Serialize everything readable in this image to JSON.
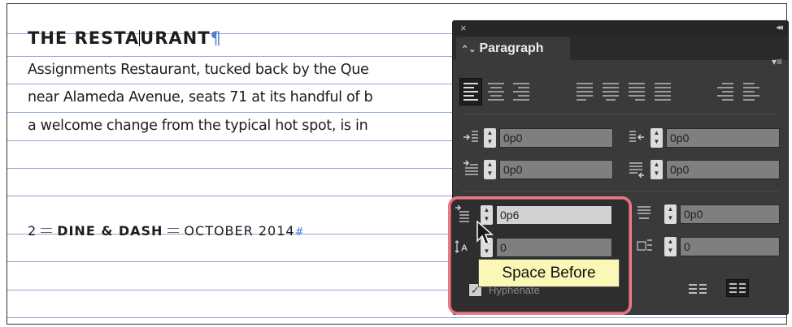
{
  "document": {
    "heading": "THE RESTAURANT",
    "heading_before_caret": "THE RESTA",
    "heading_after_caret": "URANT",
    "pilcrow": "¶",
    "body_lines": [
      "Assignments Restaurant, tucked back by the Que",
      "near Alameda Avenue, seats 71 at its handful of b",
      "a welcome change from the typical hot spot, is in"
    ],
    "footer": {
      "page_number": "2",
      "section": "DINE & DASH",
      "date": "OCTOBER 2014",
      "marker": "#"
    }
  },
  "panel": {
    "close_glyph": "×",
    "collapse_glyph": "◂◂",
    "tab_label": "Paragraph",
    "tab_sort_glyph": "⌃⌄",
    "menu_glyph": "▾≡",
    "fields": {
      "left_indent": "0p0",
      "right_indent": "0p0",
      "first_line_indent": "0p0",
      "last_line_indent": "0p0",
      "space_before": "0p6",
      "space_after": "0p0",
      "drop_cap_lines": "0",
      "drop_cap_chars": "0"
    },
    "hyphenate_label": "Hyphenate",
    "hyphenate_checked": true
  },
  "tooltip": "Space Before",
  "colors": {
    "panel_bg": "#3a3a3a",
    "highlight_ring": "#e87a86",
    "tooltip_bg": "#fbf7b6",
    "baseline_grid": "#8fa6d6",
    "pilcrow_blue": "#4d7fd6"
  }
}
